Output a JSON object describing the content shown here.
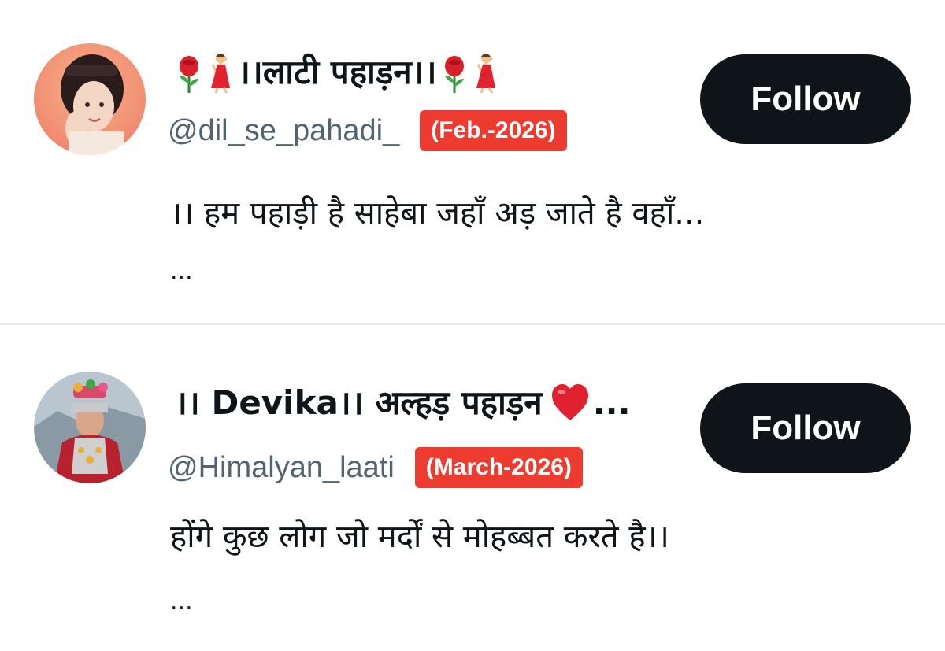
{
  "accounts": [
    {
      "display_name": "।।लाटी पहाड़न।।",
      "handle": "@dil_se_pahadi_",
      "date_badge": "(Feb.-2026)",
      "bio": "।। हम पहाड़ी है साहेबा जहाँ अड़ जाते है वहाँ...",
      "more": "...",
      "follow_label": "Follow",
      "name_emojis": [
        "rose-icon",
        "dancer-icon",
        "rose-icon",
        "dancer-icon"
      ]
    },
    {
      "display_name": "।। Devika।। अल्हड़ पहाड़न",
      "name_suffix": "...",
      "handle": "@Himalyan_laati",
      "date_badge": "(March-2026)",
      "bio": "होंगे कुछ लोग जो मर्दों से मोहब्बत करते है।।",
      "more": "...",
      "follow_label": "Follow",
      "name_emojis": [
        "red-heart-icon"
      ]
    }
  ],
  "colors": {
    "badge": "#ee3b30",
    "button": "#0f1419",
    "handle": "#536471",
    "divider": "#e6e9ec"
  }
}
